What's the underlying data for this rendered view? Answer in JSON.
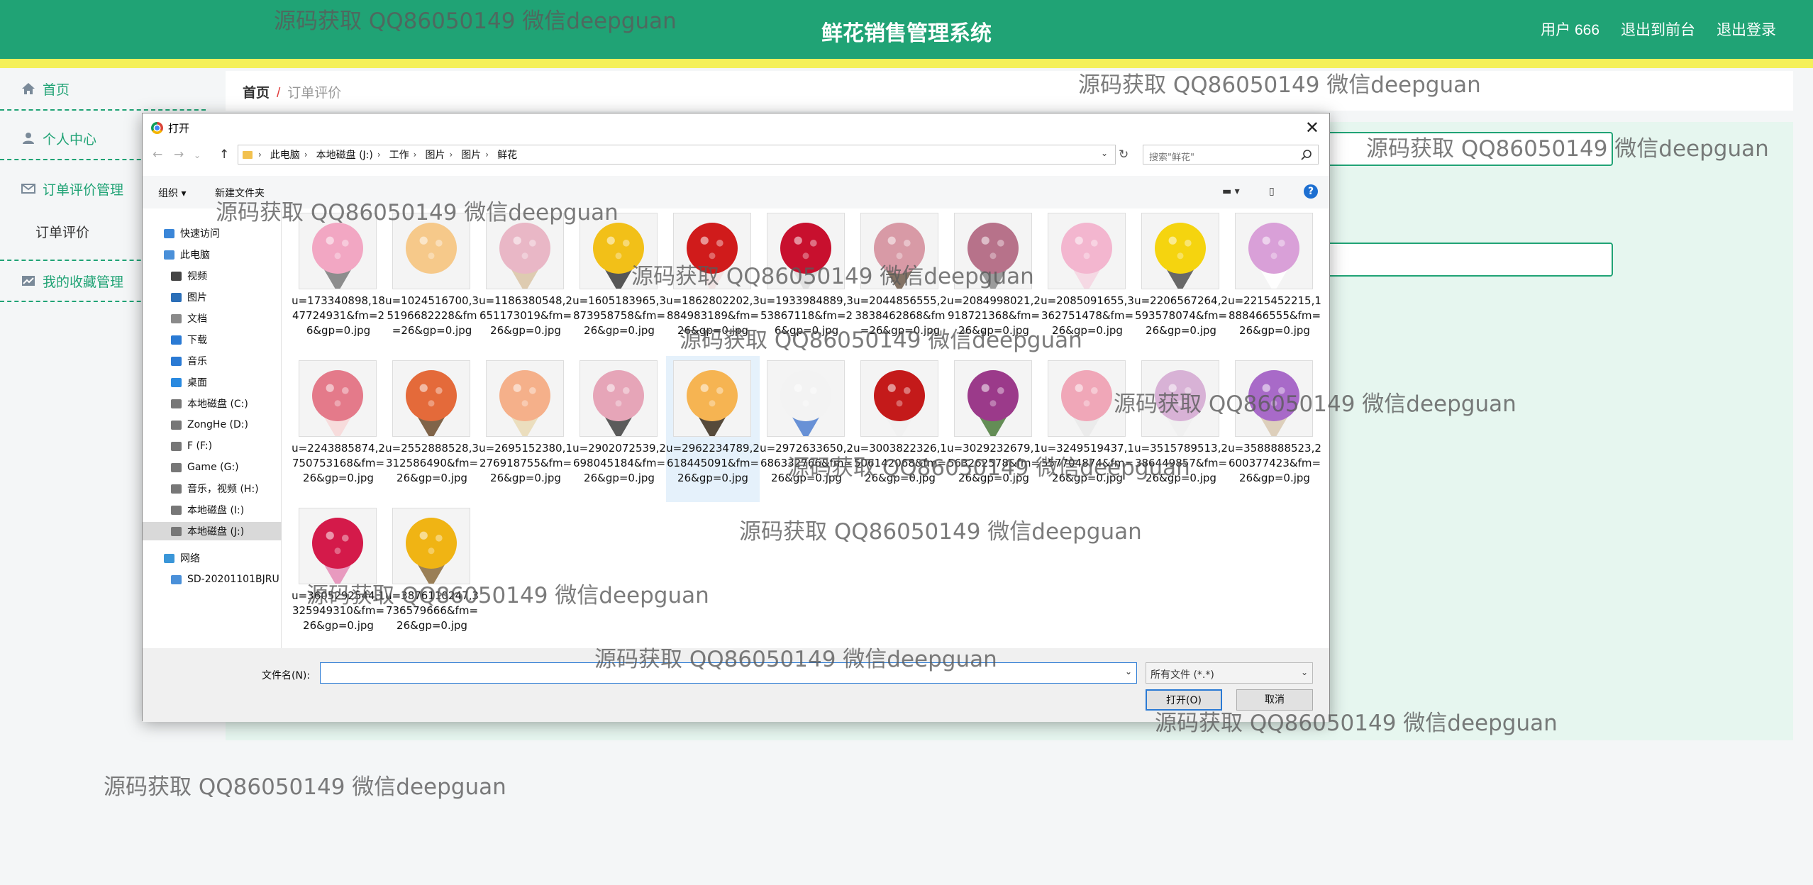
{
  "app": {
    "title": "鲜花销售管理系统",
    "user_link": "用户 666",
    "front_link": "退出到前台",
    "logout_link": "退出登录"
  },
  "sidebar": {
    "items": [
      {
        "label": "首页"
      },
      {
        "label": "个人中心"
      },
      {
        "label": "订单评价管理"
      },
      {
        "label": "订单评价"
      },
      {
        "label": "我的收藏管理"
      }
    ]
  },
  "breadcrumb": {
    "home": "首页",
    "separator": "/",
    "current": "订单评价"
  },
  "watermark": "源码获取 QQ86050149 微信deepguan",
  "dialog": {
    "title": "打开",
    "path": [
      "此电脑",
      "本地磁盘 (J:)",
      "工作",
      "图片",
      "图片",
      "鲜花"
    ],
    "search_placeholder": "搜索\"鲜花\"",
    "organize": "组织 ▾",
    "new_folder": "新建文件夹",
    "nav": [
      {
        "label": "快速访问",
        "icon": "star-icon"
      },
      {
        "label": "此电脑",
        "icon": "computer-icon"
      },
      {
        "label": "视频",
        "icon": "video-icon"
      },
      {
        "label": "图片",
        "icon": "picture-icon"
      },
      {
        "label": "文档",
        "icon": "document-icon"
      },
      {
        "label": "下载",
        "icon": "download-icon"
      },
      {
        "label": "音乐",
        "icon": "music-icon"
      },
      {
        "label": "桌面",
        "icon": "desktop-icon"
      },
      {
        "label": "本地磁盘 (C:)",
        "icon": "drive-icon"
      },
      {
        "label": "ZongHe (D:)",
        "icon": "drive-icon"
      },
      {
        "label": "F (F:)",
        "icon": "drive-icon"
      },
      {
        "label": "Game (G:)",
        "icon": "drive-icon"
      },
      {
        "label": "音乐，视频 (H:)",
        "icon": "drive-icon"
      },
      {
        "label": "本地磁盘 (I:)",
        "icon": "drive-icon"
      },
      {
        "label": "本地磁盘 (J:)",
        "icon": "drive-icon"
      },
      {
        "label": "网络",
        "icon": "network-icon"
      },
      {
        "label": "SD-20201101BJRU",
        "icon": "computer-icon"
      }
    ],
    "files": [
      {
        "name": "u=173340898,1847724931&fm=26&gp=0.jpg",
        "flower": "#f2a7c3",
        "paper": "#7a7a7a"
      },
      {
        "name": "u=1024516700,35196682228&fm=26&gp=0.jpg",
        "flower": "#f6c98a",
        "paper": "#f3f3f3"
      },
      {
        "name": "u=1186380548,2651173019&fm=26&gp=0.jpg",
        "flower": "#e9b7c6",
        "paper": "#d9c3a5"
      },
      {
        "name": "u=1605183965,3873958758&fm=26&gp=0.jpg",
        "flower": "#f2c018",
        "paper": "#3a3a3a"
      },
      {
        "name": "u=1862802202,3884983189&fm=26&gp=0.jpg",
        "flower": "#d01b1b",
        "paper": "#f0e0e0"
      },
      {
        "name": "u=1933984889,353867118&fm=26&gp=0.jpg",
        "flower": "#c8102e",
        "paper": "#dddddd"
      },
      {
        "name": "u=2044856555,23838462868&fm=26&gp=0.jpg",
        "flower": "#d89aa6",
        "paper": "#6e5a4a"
      },
      {
        "name": "u=2084998021,2918721368&fm=26&gp=0.jpg",
        "flower": "#b7728a",
        "paper": "#8a8a8a"
      },
      {
        "name": "u=2085091655,3362751478&fm=26&gp=0.jpg",
        "flower": "#f3b6cf",
        "paper": "#f5d3e1"
      },
      {
        "name": "u=2206567264,2593578074&fm=26&gp=0.jpg",
        "flower": "#f5d40f",
        "paper": "#4f4f4f"
      },
      {
        "name": "u=2215452215,1888466555&fm=26&gp=0.jpg",
        "flower": "#d9a0d8",
        "paper": "#ffffff"
      },
      {
        "name": "u=2243885874,2750753168&fm=26&gp=0.jpg",
        "flower": "#e47a8a",
        "paper": "#f7d7d7"
      },
      {
        "name": "u=2552888528,3312586490&fm=26&gp=0.jpg",
        "flower": "#e46a3a",
        "paper": "#6b4a2a"
      },
      {
        "name": "u=2695152380,1276918755&fm=26&gp=0.jpg",
        "flower": "#f5b08a",
        "paper": "#e9d9b4"
      },
      {
        "name": "u=2902072539,2698045184&fm=26&gp=0.jpg",
        "flower": "#e6a5b8",
        "paper": "#404040"
      },
      {
        "name": "u=2962234789,2618445091&fm=26&gp=0.jpg",
        "flower": "#f6b452",
        "paper": "#3a2b1a"
      },
      {
        "name": "u=2972633650,2686332766&fm=26&gp=0.jpg",
        "flower": "#f3f3f3",
        "paper": "#4f7fd0"
      },
      {
        "name": "u=3003822326,1506142068&fm=26&gp=0.jpg",
        "flower": "#c41a1a",
        "paper": "#f0f0f0"
      },
      {
        "name": "u=3029232679,1563262578&fm=26&gp=0.jpg",
        "flower": "#9b3a8a",
        "paper": "#4a7a3a"
      },
      {
        "name": "u=3249519437,1557704874&fm=26&gp=0.jpg",
        "flower": "#f0a7b8",
        "paper": "#e9e9e9"
      },
      {
        "name": "u=3515789513,2386449857&fm=26&gp=0.jpg",
        "flower": "#d8b2d6",
        "paper": "#eeeeee"
      },
      {
        "name": "u=3588888523,2600377423&fm=26&gp=0.jpg",
        "flower": "#a86ac8",
        "paper": "#d8c8b0"
      },
      {
        "name": "u=3605292544,1325949310&fm=26&gp=0.jpg",
        "flower": "#d41a4a",
        "paper": "#e58ab5"
      },
      {
        "name": "u=3876110247,3736579666&fm=26&gp=0.jpg",
        "flower": "#f0b414",
        "paper": "#8a6a3a"
      }
    ],
    "filename_label": "文件名(N):",
    "filename_value": "",
    "filetype": "所有文件 (*.*)",
    "open_btn": "打开(O)",
    "cancel_btn": "取消"
  },
  "colors": {
    "brand": "#20a375",
    "stripe": "#f4f05a",
    "accent": "#2a7ad4"
  }
}
